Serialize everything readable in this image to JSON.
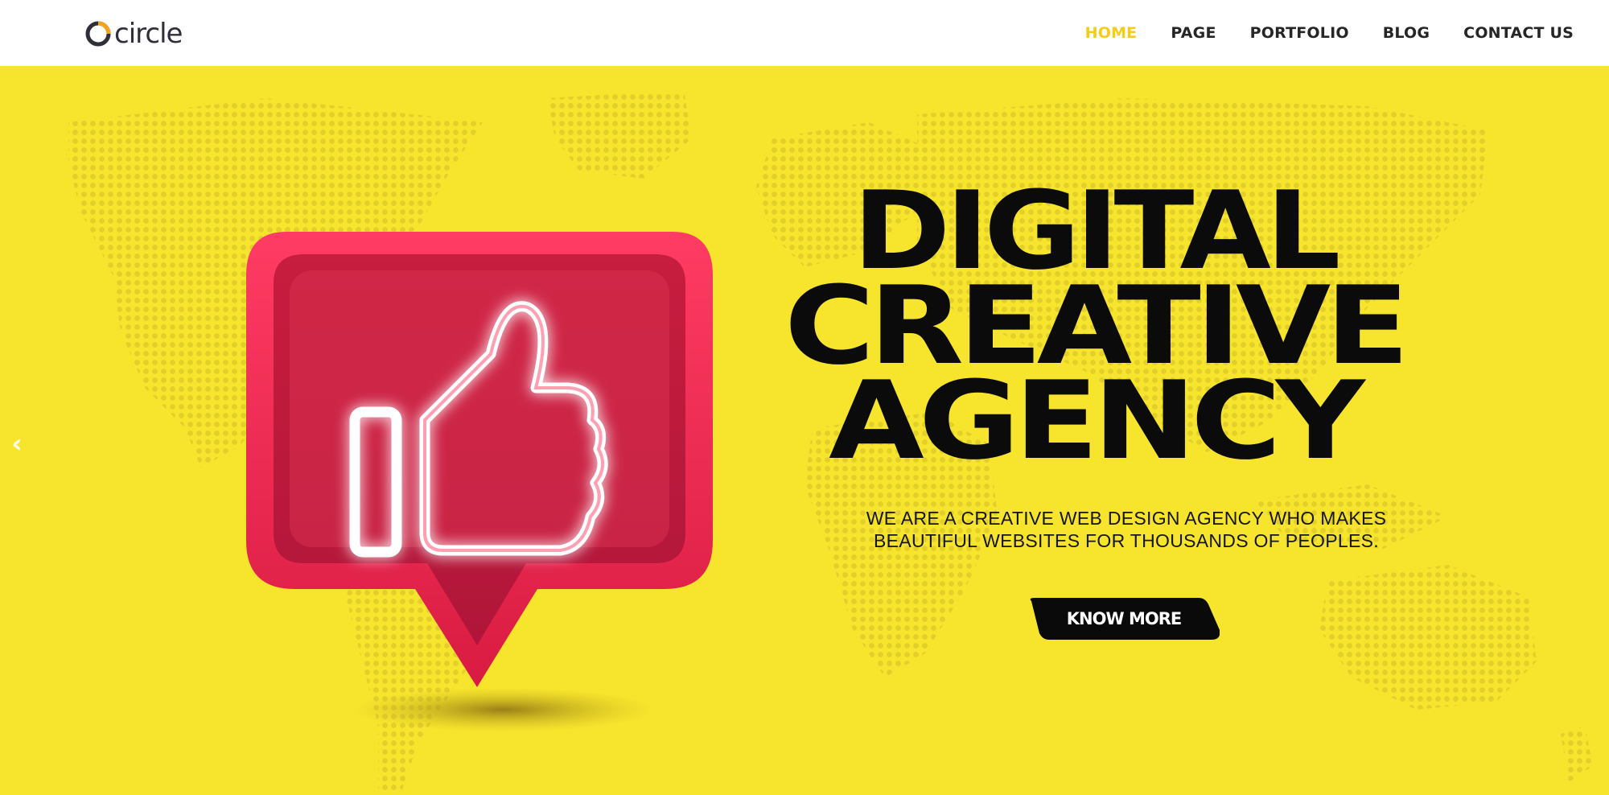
{
  "brand": {
    "name": "circle",
    "logo_icon": "circle-logo-icon",
    "accent_color": "#f3a51a"
  },
  "nav": {
    "items": [
      {
        "label": "HOME",
        "active": true
      },
      {
        "label": "PAGE",
        "active": false
      },
      {
        "label": "PORTFOLIO",
        "active": false
      },
      {
        "label": "BLOG",
        "active": false
      },
      {
        "label": "CONTACT US",
        "active": false
      }
    ],
    "active_color": "#f3cc1c"
  },
  "hero": {
    "background_color": "#f7e52d",
    "background_graphic": "dotted-world-map",
    "headline": {
      "line1": "DIGITAL",
      "line2": "CREATIVE",
      "line3": "AGENCY"
    },
    "subtext": {
      "line1": "WE ARE A CREATIVE WEB DESIGN AGENCY WHO MAKES",
      "line2": "BEAUTIFUL WEBSITES FOR THOUSANDS OF PEOPLES."
    },
    "cta_label": "KNOW MORE",
    "prev_arrow": "‹",
    "graphic": "neon-thumbs-up-speech-bubble",
    "graphic_color": "#e0264a"
  }
}
